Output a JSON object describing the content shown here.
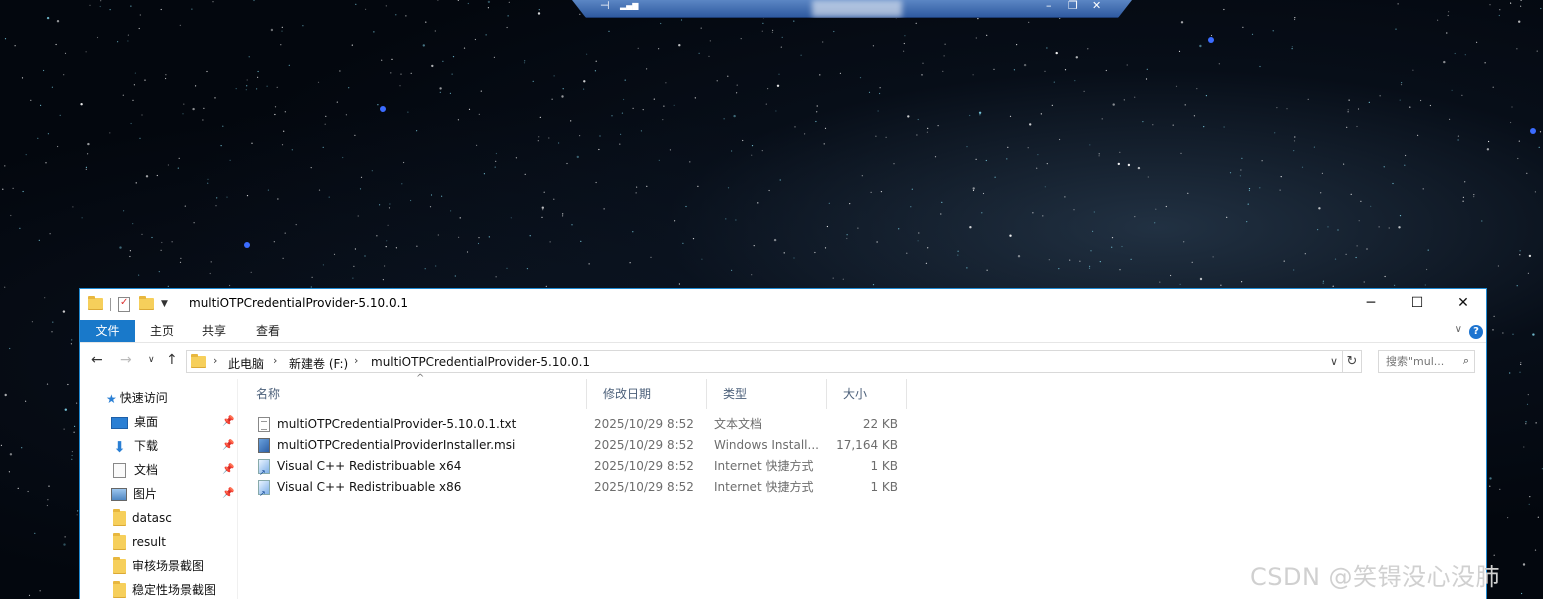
{
  "window": {
    "title": "multiOTPCredentialProvider-5.10.0.1",
    "minimize_glyph": "─",
    "maximize_glyph": "☐",
    "close_glyph": "✕"
  },
  "remote_bar": {
    "pin_glyph": "⊣",
    "signal_glyph": "▂▄▆",
    "minimize_glyph": "–",
    "restore_glyph": "❐",
    "close_glyph": "✕"
  },
  "ribbon": {
    "tabs": [
      "文件",
      "主页",
      "共享",
      "查看"
    ],
    "expand_glyph": "∨",
    "help_glyph": "?"
  },
  "address": {
    "back_glyph": "←",
    "forward_glyph": "→",
    "recent_glyph": "∨",
    "up_glyph": "↑",
    "separator": "›",
    "crumbs": [
      "此电脑",
      "新建卷 (F:)",
      "multiOTPCredentialProvider-5.10.0.1"
    ],
    "dropdown_glyph": "∨",
    "refresh_glyph": "↻"
  },
  "search": {
    "placeholder": "搜索\"mul...",
    "icon_glyph": "⌕"
  },
  "nav": {
    "quick_access": "快速访问",
    "pin_glyph": "📌",
    "items": [
      {
        "label": "桌面",
        "icon": "desktop-icon",
        "pinned": true
      },
      {
        "label": "下载",
        "icon": "download-icon",
        "pinned": true
      },
      {
        "label": "文档",
        "icon": "document-icon",
        "pinned": true
      },
      {
        "label": "图片",
        "icon": "picture-icon",
        "pinned": true
      },
      {
        "label": "datasc",
        "icon": "folder-icon",
        "pinned": false
      },
      {
        "label": "result",
        "icon": "folder-icon",
        "pinned": false
      },
      {
        "label": "审核场景截图",
        "icon": "folder-icon",
        "pinned": false
      },
      {
        "label": "稳定性场景截图",
        "icon": "folder-icon",
        "pinned": false
      }
    ]
  },
  "columns": {
    "name": "名称",
    "modified": "修改日期",
    "type": "类型",
    "size": "大小",
    "sort_glyph": "^"
  },
  "files": [
    {
      "name": "multiOTPCredentialProvider-5.10.0.1.txt",
      "modified": "2025/10/29 8:52",
      "type": "文本文档",
      "size": "22 KB",
      "icon": "text-file-icon"
    },
    {
      "name": "multiOTPCredentialProviderInstaller.msi",
      "modified": "2025/10/29 8:52",
      "type": "Windows Install...",
      "size": "17,164 KB",
      "icon": "msi-installer-icon"
    },
    {
      "name": "Visual C++ Redistribuable x64",
      "modified": "2025/10/29 8:52",
      "type": "Internet 快捷方式",
      "size": "1 KB",
      "icon": "internet-shortcut-icon"
    },
    {
      "name": "Visual C++ Redistribuable x86",
      "modified": "2025/10/29 8:52",
      "type": "Internet 快捷方式",
      "size": "1 KB",
      "icon": "internet-shortcut-icon"
    }
  ],
  "watermark": "CSDN @笑锝没心没肺"
}
